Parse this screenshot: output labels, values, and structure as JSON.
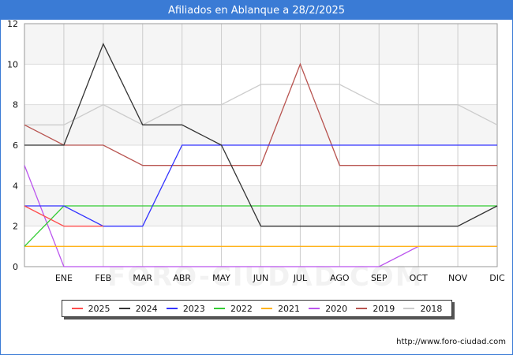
{
  "header": {
    "title": "Afiliados en Ablanque a 28/2/2025"
  },
  "footer": {
    "url": "http://www.foro-ciudad.com"
  },
  "watermark": "FORO-CIUDAD.COM",
  "chart_data": {
    "type": "line",
    "title": "Afiliados en Ablanque a 28/2/2025",
    "x": [
      "",
      "ENE",
      "FEB",
      "MAR",
      "ABR",
      "MAY",
      "JUN",
      "JUL",
      "AGO",
      "SEP",
      "OCT",
      "NOV",
      "DIC"
    ],
    "ylim": [
      0,
      12
    ],
    "yticks": [
      0,
      2,
      4,
      6,
      8,
      10,
      12
    ],
    "grid": true,
    "legend_position": "bottom",
    "series": [
      {
        "name": "2025",
        "color": "#ff4d4d",
        "values": [
          3,
          2,
          2
        ]
      },
      {
        "name": "2024",
        "color": "#333333",
        "values": [
          6,
          6,
          11,
          7,
          7,
          6,
          2,
          2,
          2,
          2,
          2,
          2,
          3
        ]
      },
      {
        "name": "2023",
        "color": "#3333ff",
        "values": [
          3,
          3,
          2,
          2,
          6,
          6,
          6,
          6,
          6,
          6,
          6,
          6,
          6
        ]
      },
      {
        "name": "2022",
        "color": "#33cc33",
        "values": [
          1,
          3,
          3,
          3,
          3,
          3,
          3,
          3,
          3,
          3,
          3,
          3,
          3
        ]
      },
      {
        "name": "2021",
        "color": "#ffb31a",
        "values": [
          1,
          1,
          1,
          1,
          1,
          1,
          1,
          1,
          1,
          1,
          1,
          1,
          1
        ]
      },
      {
        "name": "2020",
        "color": "#bb55ee",
        "values": [
          5,
          0,
          0,
          0,
          0,
          0,
          0,
          0,
          0,
          0,
          1,
          1,
          1
        ]
      },
      {
        "name": "2019",
        "color": "#b85450",
        "values": [
          7,
          6,
          6,
          5,
          5,
          5,
          5,
          10,
          5,
          5,
          5,
          5,
          5
        ]
      },
      {
        "name": "2018",
        "color": "#cccccc",
        "values": [
          7,
          7,
          8,
          7,
          8,
          8,
          9,
          9,
          9,
          8,
          8,
          8,
          7
        ]
      }
    ]
  }
}
